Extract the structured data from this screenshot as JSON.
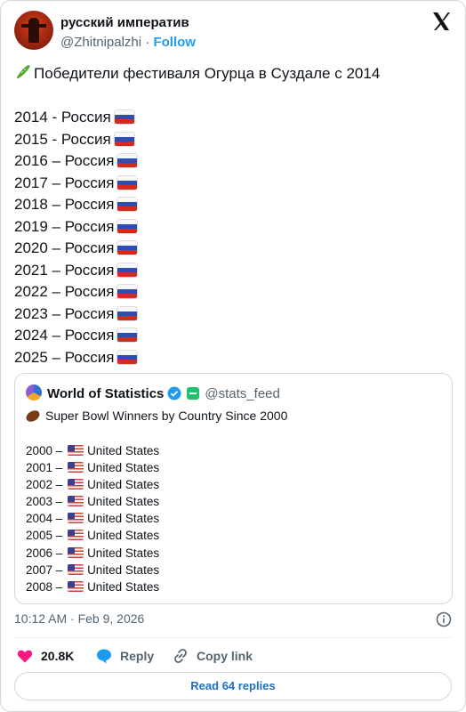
{
  "author": {
    "name": "русский императив",
    "handle": "@Zhitnipalzhi",
    "separator": "·",
    "follow_label": "Follow"
  },
  "tweet": {
    "headline": "Победители фестиваля Огурца в Суздале с 2014",
    "headline_icon": "cucumber-emoji",
    "entries": [
      {
        "text": "2014 - Россия",
        "flag": "russia"
      },
      {
        "text": "2015 - Россия",
        "flag": "russia"
      },
      {
        "text": "2016 – Россия",
        "flag": "russia"
      },
      {
        "text": "2017 – Россия",
        "flag": "russia"
      },
      {
        "text": "2018 – Россия",
        "flag": "russia"
      },
      {
        "text": "2019 – Россия",
        "flag": "russia"
      },
      {
        "text": "2020 – Россия",
        "flag": "russia"
      },
      {
        "text": "2021 – Россия",
        "flag": "russia"
      },
      {
        "text": "2022 – Россия",
        "flag": "russia"
      },
      {
        "text": "2023 – Россия",
        "flag": "russia"
      },
      {
        "text": "2024 – Россия",
        "flag": "russia"
      },
      {
        "text": "2025 – Россия",
        "flag": "russia"
      }
    ]
  },
  "quoted": {
    "name": "World of Statistics",
    "handle": "@stats_feed",
    "text": "Super Bowl Winners by Country Since 2000",
    "text_icon": "american-football-emoji",
    "entries": [
      {
        "year": "2000 –",
        "country": "United States"
      },
      {
        "year": "2001 –",
        "country": "United States"
      },
      {
        "year": "2002 –",
        "country": "United States"
      },
      {
        "year": "2003 –",
        "country": "United States"
      },
      {
        "year": "2004 –",
        "country": "United States"
      },
      {
        "year": "2005 –",
        "country": "United States"
      },
      {
        "year": "2006 –",
        "country": "United States"
      },
      {
        "year": "2007 –",
        "country": "United States"
      },
      {
        "year": "2008 –",
        "country": "United States"
      }
    ]
  },
  "meta": {
    "timestamp": "10:12 AM · Feb 9, 2026"
  },
  "actions": {
    "likes": "20.8K",
    "reply_label": "Reply",
    "copy_link_label": "Copy link",
    "read_replies_label": "Read 64 replies"
  },
  "colors": {
    "accent": "#1d9bf0",
    "like": "#f91880",
    "muted_text": "#536471"
  }
}
